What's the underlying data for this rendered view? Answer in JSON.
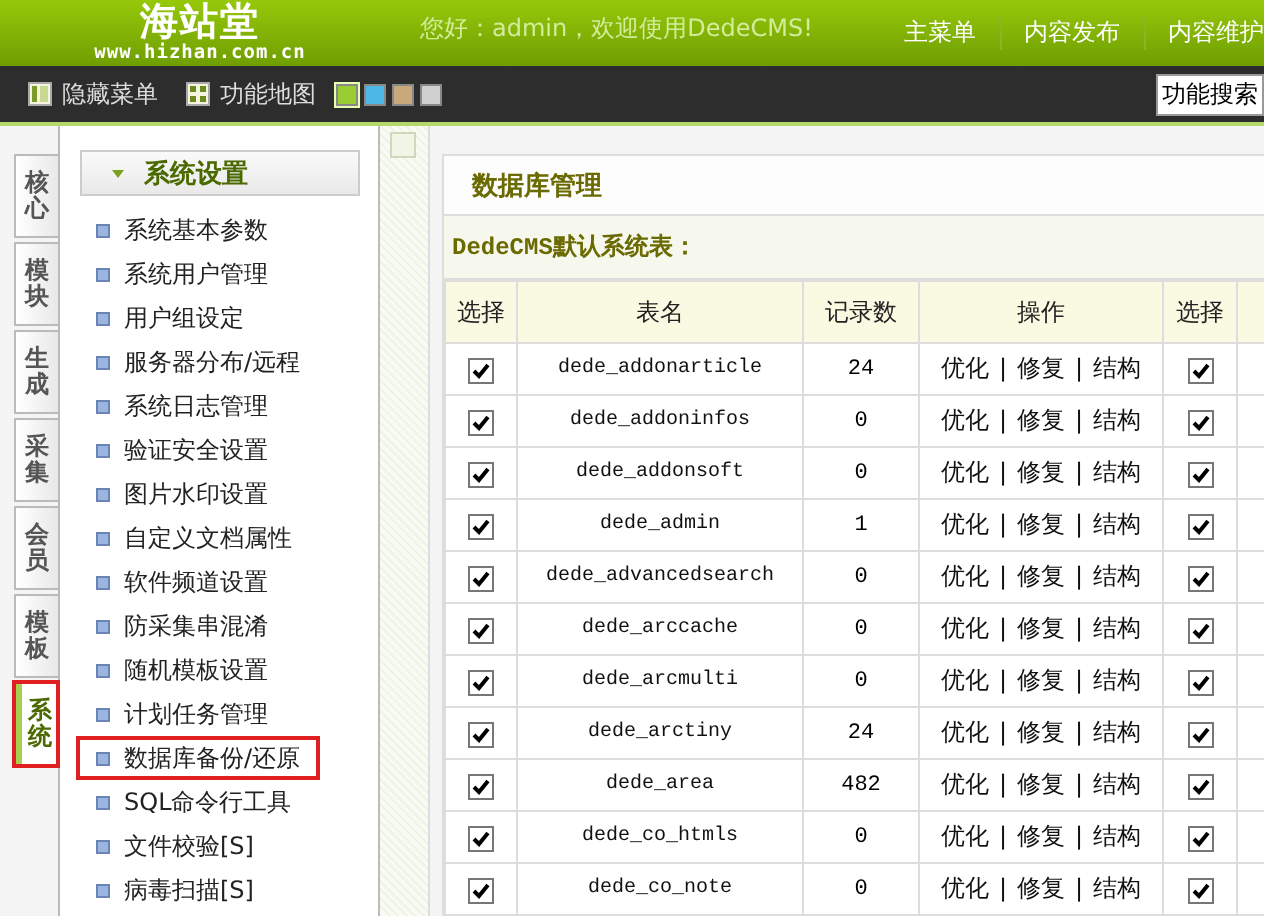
{
  "header": {
    "logo": "海站堂",
    "logo_url": "www.hizhan.com.cn",
    "greeting": "您好：admin，欢迎使用DedeCMS!",
    "menu": [
      "主菜单",
      "内容发布",
      "内容维护"
    ]
  },
  "toolbar": {
    "items": [
      "隐藏菜单",
      "功能地图"
    ],
    "skins": [
      {
        "color": "#9acd32",
        "selected": true
      },
      {
        "color": "#4db8e8",
        "selected": false
      },
      {
        "color": "#c8aa7a",
        "selected": false
      },
      {
        "color": "#d0d0d0",
        "selected": false
      }
    ],
    "search_button": "功能搜索"
  },
  "side_tabs": [
    {
      "label": "核心",
      "selected": false,
      "highlighted": false
    },
    {
      "label": "模块",
      "selected": false,
      "highlighted": false
    },
    {
      "label": "生成",
      "selected": false,
      "highlighted": false
    },
    {
      "label": "采集",
      "selected": false,
      "highlighted": false
    },
    {
      "label": "会员",
      "selected": false,
      "highlighted": false
    },
    {
      "label": "模板",
      "selected": false,
      "highlighted": false
    },
    {
      "label": "系统",
      "selected": true,
      "highlighted": true
    }
  ],
  "side_menu": {
    "title": "系统设置",
    "items": [
      {
        "label": "系统基本参数",
        "highlighted": false
      },
      {
        "label": "系统用户管理",
        "highlighted": false
      },
      {
        "label": "用户组设定",
        "highlighted": false
      },
      {
        "label": "服务器分布/远程",
        "highlighted": false
      },
      {
        "label": "系统日志管理",
        "highlighted": false
      },
      {
        "label": "验证安全设置",
        "highlighted": false
      },
      {
        "label": "图片水印设置",
        "highlighted": false
      },
      {
        "label": "自定义文档属性",
        "highlighted": false
      },
      {
        "label": "软件频道设置",
        "highlighted": false
      },
      {
        "label": "防采集串混淆",
        "highlighted": false
      },
      {
        "label": "随机模板设置",
        "highlighted": false
      },
      {
        "label": "计划任务管理",
        "highlighted": false
      },
      {
        "label": "数据库备份/还原",
        "highlighted": true
      },
      {
        "label": "SQL命令行工具",
        "highlighted": false
      },
      {
        "label": "文件校验[S]",
        "highlighted": false
      },
      {
        "label": "病毒扫描[S]",
        "highlighted": false
      }
    ]
  },
  "panel": {
    "title": "数据库管理",
    "subtitle": "DedeCMS默认系统表：",
    "columns": [
      "选择",
      "表名",
      "记录数",
      "操作",
      "选择"
    ],
    "separator": "|",
    "rows": [
      {
        "checked": true,
        "name": "dede_addonarticle",
        "count": "24",
        "actions": [
          "优化",
          "修复",
          "结构"
        ],
        "checked_2": true
      },
      {
        "checked": true,
        "name": "dede_addoninfos",
        "count": "0",
        "actions": [
          "优化",
          "修复",
          "结构"
        ],
        "checked_2": true
      },
      {
        "checked": true,
        "name": "dede_addonsoft",
        "count": "0",
        "actions": [
          "优化",
          "修复",
          "结构"
        ],
        "checked_2": true
      },
      {
        "checked": true,
        "name": "dede_admin",
        "count": "1",
        "actions": [
          "优化",
          "修复",
          "结构"
        ],
        "checked_2": true
      },
      {
        "checked": true,
        "name": "dede_advancedsearch",
        "count": "0",
        "actions": [
          "优化",
          "修复",
          "结构"
        ],
        "checked_2": true
      },
      {
        "checked": true,
        "name": "dede_arccache",
        "count": "0",
        "actions": [
          "优化",
          "修复",
          "结构"
        ],
        "checked_2": true
      },
      {
        "checked": true,
        "name": "dede_arcmulti",
        "count": "0",
        "actions": [
          "优化",
          "修复",
          "结构"
        ],
        "checked_2": true
      },
      {
        "checked": true,
        "name": "dede_arctiny",
        "count": "24",
        "actions": [
          "优化",
          "修复",
          "结构"
        ],
        "checked_2": true
      },
      {
        "checked": true,
        "name": "dede_area",
        "count": "482",
        "actions": [
          "优化",
          "修复",
          "结构"
        ],
        "checked_2": true
      },
      {
        "checked": true,
        "name": "dede_co_htmls",
        "count": "0",
        "actions": [
          "优化",
          "修复",
          "结构"
        ],
        "checked_2": true
      },
      {
        "checked": true,
        "name": "dede_co_note",
        "count": "0",
        "actions": [
          "优化",
          "修复",
          "结构"
        ],
        "checked_2": true
      }
    ]
  }
}
